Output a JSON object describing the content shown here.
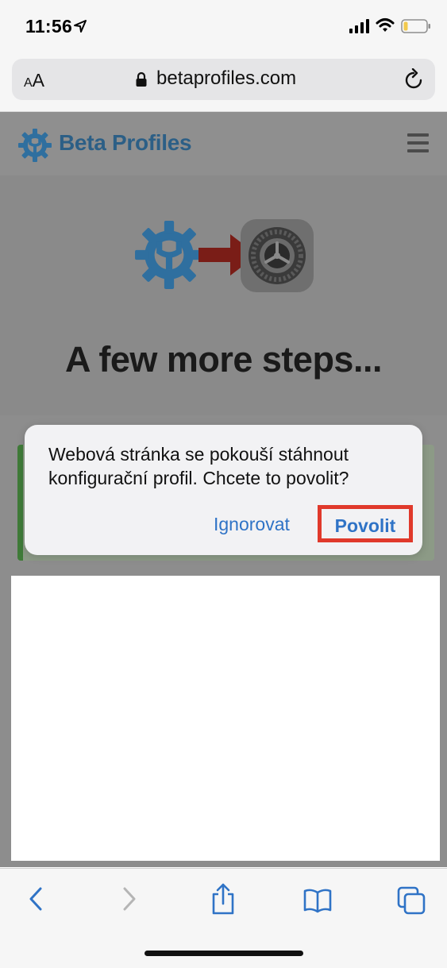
{
  "status_bar": {
    "time": "11:56"
  },
  "address_bar": {
    "text_size_label_small": "A",
    "text_size_label_big": "A",
    "url": "betaprofiles.com"
  },
  "site": {
    "name": "Beta Profiles",
    "hero_title": "A few more steps..."
  },
  "dialog": {
    "message": "Webová stránka se pokouší stáhnout konfigurační profil. Chcete to povolit?",
    "ignore_label": "Ignorovat",
    "allow_label": "Povolit"
  },
  "icons": {
    "location": "location-arrow-icon",
    "signal": "cellular-signal-icon",
    "wifi": "wifi-icon",
    "battery": "battery-icon",
    "lock": "lock-icon",
    "reload": "reload-icon",
    "menu": "hamburger-menu-icon",
    "back": "back-chevron-icon",
    "forward": "forward-chevron-icon",
    "share": "share-icon",
    "bookmarks": "bookmarks-icon",
    "tabs": "tabs-icon"
  },
  "colors": {
    "brand_blue": "#3b8fd3",
    "link_blue": "#2f73c6",
    "highlight_red": "#e0392b",
    "success_green": "#3f7b38"
  }
}
